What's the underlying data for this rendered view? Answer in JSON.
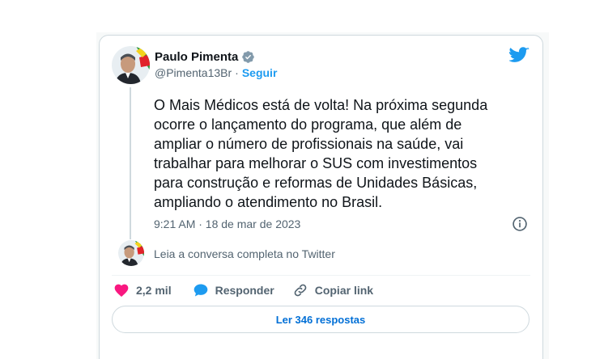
{
  "author": {
    "name": "Paulo Pimenta",
    "handle": "@Pimenta13Br",
    "separator": "·",
    "follow_label": "Seguir"
  },
  "icons": {
    "verified": "verified-badge-icon",
    "brand": "twitter-bird-icon",
    "info": "info-icon",
    "like": "heart-icon",
    "reply": "speech-bubble-icon",
    "copy": "link-icon"
  },
  "colors": {
    "accent": "#1d9bf0",
    "like": "#f91880",
    "link_button": "#006fd6"
  },
  "tweet": {
    "text": "O Mais Médicos está de volta! Na próxima segunda\nocorre o lançamento do programa, que além de\nampliar o número de profissionais na saúde, vai\ntrabalhar para melhorar o SUS com investimentos\npara construção e reformas de Unidades Básicas,\nampliando o atendimento no Brasil.",
    "timestamp": "9:21 AM · 18 de mar de 2023"
  },
  "conversation_link": "Leia a conversa completa no Twitter",
  "actions": {
    "likes": "2,2 mil",
    "reply": "Responder",
    "copy_link": "Copiar link"
  },
  "read_replies": "Ler 346 respostas"
}
